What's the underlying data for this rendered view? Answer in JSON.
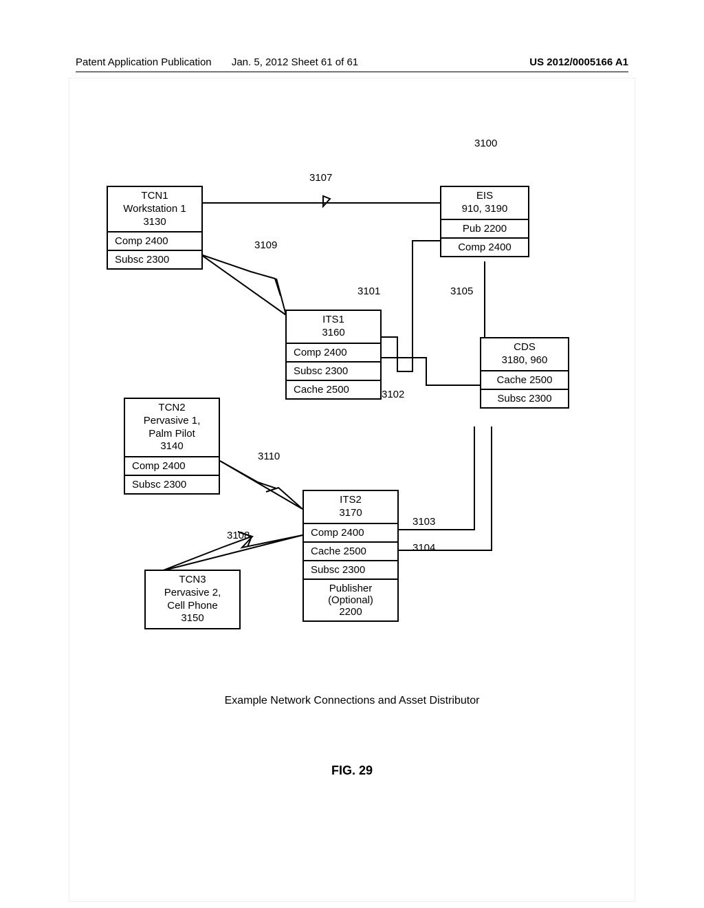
{
  "header": {
    "left": "Patent Application Publication",
    "mid": "Jan. 5, 2012   Sheet 61 of 61",
    "right": "US 2012/0005166 A1"
  },
  "labels": {
    "ref3100": "3100",
    "ref3107": "3107",
    "ref3109": "3109",
    "ref3101": "3101",
    "ref3105": "3105",
    "ref3102": "3102",
    "ref3110": "3110",
    "ref3108": "3108",
    "ref3103": "3103",
    "ref3104": "3104"
  },
  "tcn1": {
    "title1": "TCN1",
    "title2": "Workstation 1",
    "title3": "3130",
    "comp": "Comp 2400",
    "subsc": "Subsc 2300"
  },
  "eis": {
    "title1": "EIS",
    "title2": "910, 3190",
    "pub": "Pub 2200",
    "comp": "Comp 2400"
  },
  "its1": {
    "title1": "ITS1",
    "title2": "3160",
    "comp": "Comp 2400",
    "subsc": "Subsc 2300",
    "cache": "Cache 2500"
  },
  "cds": {
    "title1": "CDS",
    "title2": "3180, 960",
    "cache": "Cache 2500",
    "subsc": "Subsc 2300"
  },
  "tcn2": {
    "title1": "TCN2",
    "title2": "Pervasive 1,",
    "title3": "Palm Pilot",
    "title4": "3140",
    "comp": "Comp 2400",
    "subsc": "Subsc 2300"
  },
  "its2": {
    "title1": "ITS2",
    "title2": "3170",
    "comp": "Comp 2400",
    "cache": "Cache 2500",
    "subsc": "Subsc 2300",
    "pub1": "Publisher",
    "pub2": "(Optional)",
    "pub3": "2200"
  },
  "tcn3": {
    "title1": "TCN3",
    "title2": "Pervasive 2,",
    "title3": "Cell Phone",
    "title4": "3150"
  },
  "caption": "Example Network Connections and Asset Distributor",
  "figure": "FIG. 29"
}
